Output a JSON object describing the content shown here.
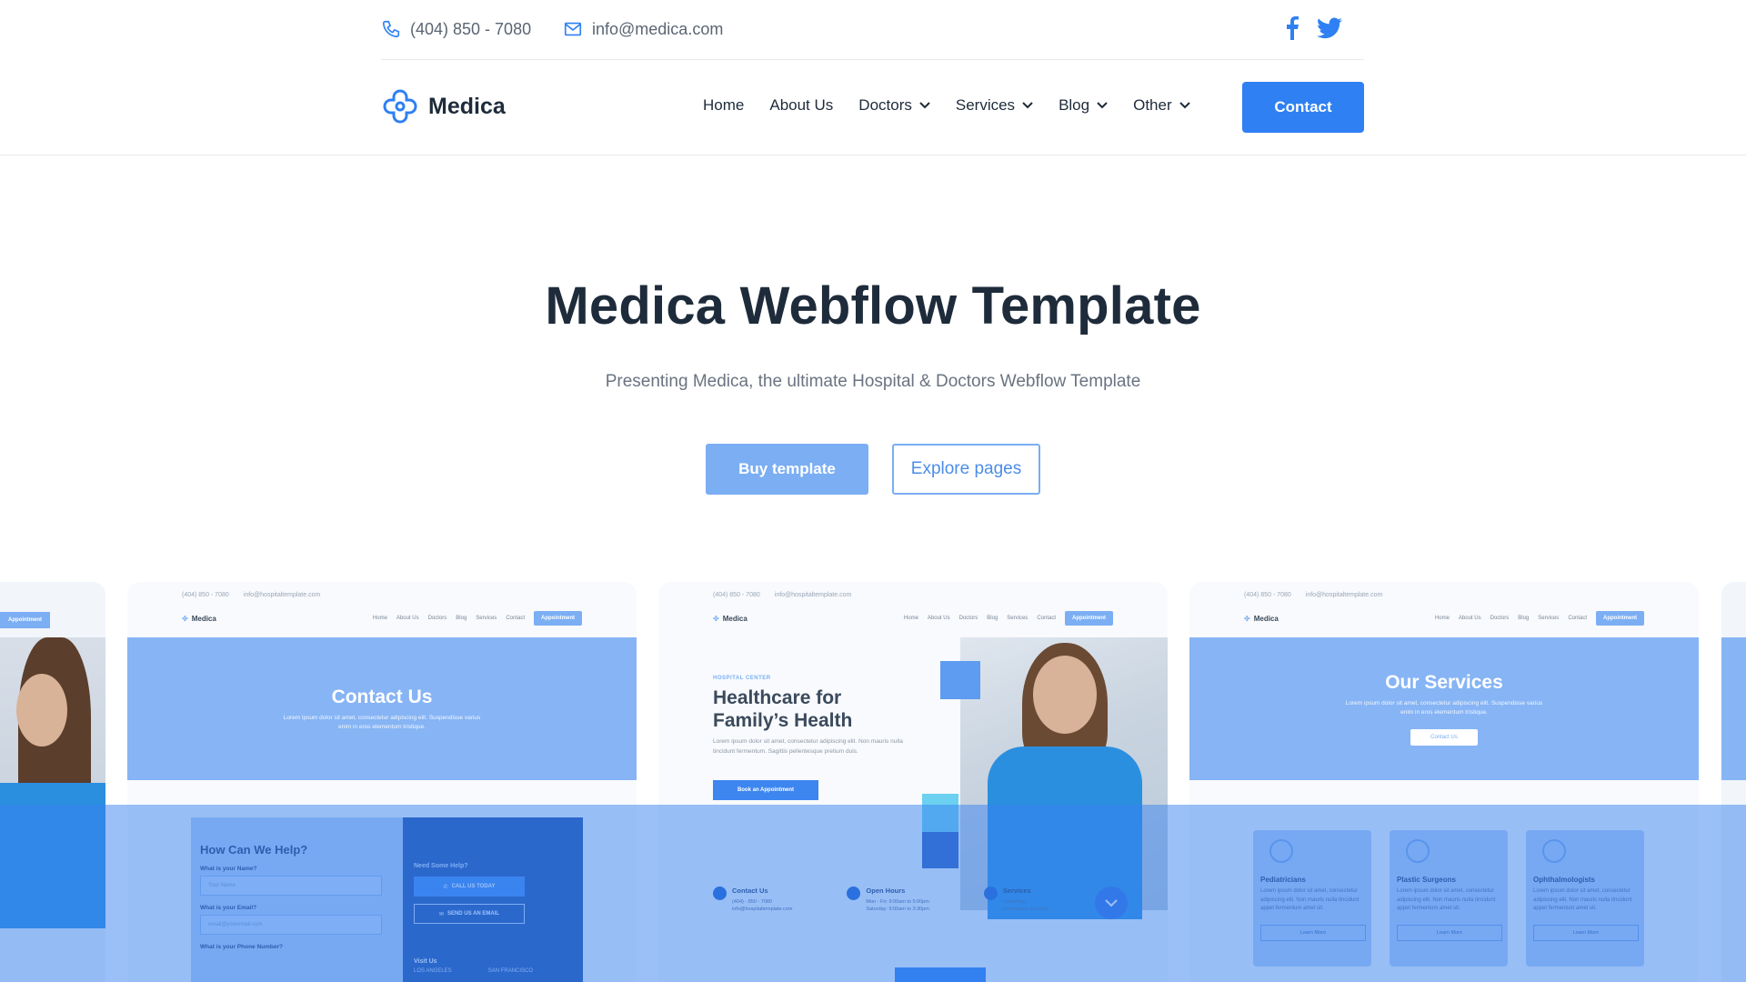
{
  "topbar": {
    "phone": "(404) 850 - 7080",
    "email": "info@medica.com",
    "socials": [
      {
        "icon": "facebook-icon"
      },
      {
        "icon": "twitter-icon"
      }
    ]
  },
  "nav": {
    "brand": "Medica",
    "items": [
      {
        "label": "Home",
        "dropdown": false
      },
      {
        "label": "About Us",
        "dropdown": false
      },
      {
        "label": "Doctors",
        "dropdown": true
      },
      {
        "label": "Services",
        "dropdown": true
      },
      {
        "label": "Blog",
        "dropdown": true
      },
      {
        "label": "Other",
        "dropdown": true
      }
    ],
    "cta": "Contact"
  },
  "hero": {
    "title": "Medica Webflow Template",
    "subtitle": "Presenting Medica, the ultimate Hospital & Doctors Webflow Template",
    "primary": "Buy template",
    "secondary": "Explore pages"
  },
  "previews": {
    "mini_phone": "(404) 850 - 7080",
    "mini_email": "info@hospitaltemplate.com",
    "mini_brand": "Medica",
    "mini_links": [
      "Home",
      "About Us",
      "Doctors",
      "Blog",
      "Services",
      "Contact"
    ],
    "mini_appt": "Appointment",
    "lorem_short": "Lorem ipsum dolor sit amet, consectetur adipiscing elit. Suspendisse varius enim in eros elementum tristique.",
    "contact": {
      "title": "Contact Us",
      "help_title": "How Can We Help?",
      "name_label": "What is your Name?",
      "name_placeholder": "Your Name",
      "email_label": "What is your Email?",
      "email_placeholder": "email@youremail.com",
      "phone_label": "What is your Phone Number?",
      "need_help": "Need Some Help?",
      "call_btn": "CALL US TODAY",
      "email_btn": "SEND US AN EMAIL",
      "visit": "Visit Us",
      "city1": "LOS ANGELES",
      "city2": "SAN FRANCISCO"
    },
    "home": {
      "tag": "HOSPITAL CENTER",
      "title_line1": "Healthcare for",
      "title_line2": "Family’s Health",
      "desc": "Lorem ipsum dolor sit amet, consectetur adipiscing elit. Non mauris nulla tincidunt fermentum. Sagittis pellentesque pretium duis.",
      "book": "Book an Appointment",
      "info": [
        {
          "title": "Contact Us",
          "l1": "(404) - 850 - 7080",
          "l2": "info@hospitaltemplate.com"
        },
        {
          "title": "Open Hours",
          "l1": "Mon - Fri: 9:00am to 5:00pm",
          "l2": "Saturday: 9:00am to 3:30pm"
        },
        {
          "title": "Services",
          "l1": "Cardiology",
          "l2": "Emergency Services"
        }
      ]
    },
    "services": {
      "title": "Our Services",
      "btn": "Contact Us",
      "cards": [
        {
          "title": "Pediatricians",
          "desc": "Lorem ipsum dolor sit amet, consectetur adipiscing elit. Non mauris nulla tincidunt appet fermentum amet sit.",
          "btn": "Learn More"
        },
        {
          "title": "Plastic Surgeons",
          "desc": "Lorem ipsum dolor sit amet, consectetur adipiscing elit. Non mauris nulla tincidunt appet fermentum amet sit.",
          "btn": "Learn More"
        },
        {
          "title": "Ophthalmologists",
          "desc": "Lorem ipsum dolor sit amet, consectetur adipiscing elit. Non mauris nulla tincidunt appet fermentum amet sit.",
          "btn": "Learn More"
        }
      ]
    }
  },
  "colors": {
    "accent": "#2f80f2",
    "accent_light": "#7baef3",
    "heading": "#1e2b3a",
    "muted": "#6a7380"
  }
}
